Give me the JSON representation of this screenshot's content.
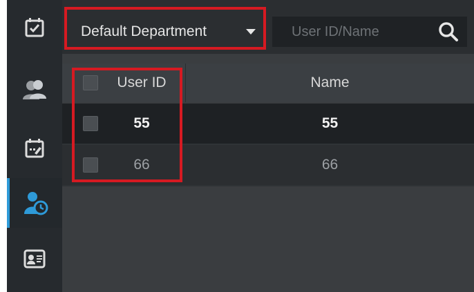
{
  "sidebar": {
    "items": [
      {
        "icon": "calendar-check-icon",
        "active": false
      },
      {
        "icon": "users-icon",
        "active": false
      },
      {
        "icon": "calendar-edit-icon",
        "active": false
      },
      {
        "icon": "user-clock-icon",
        "active": true
      },
      {
        "icon": "id-card-icon",
        "active": false
      }
    ],
    "accent": "#2e9ad8"
  },
  "toolbar": {
    "department": "Default Department",
    "search_placeholder": "User ID/Name"
  },
  "table": {
    "columns": [
      "User ID",
      "Name"
    ],
    "rows": [
      {
        "user_id": "55",
        "name": "55"
      },
      {
        "user_id": "66",
        "name": "66"
      }
    ]
  },
  "annotation_color": "#d61a22"
}
